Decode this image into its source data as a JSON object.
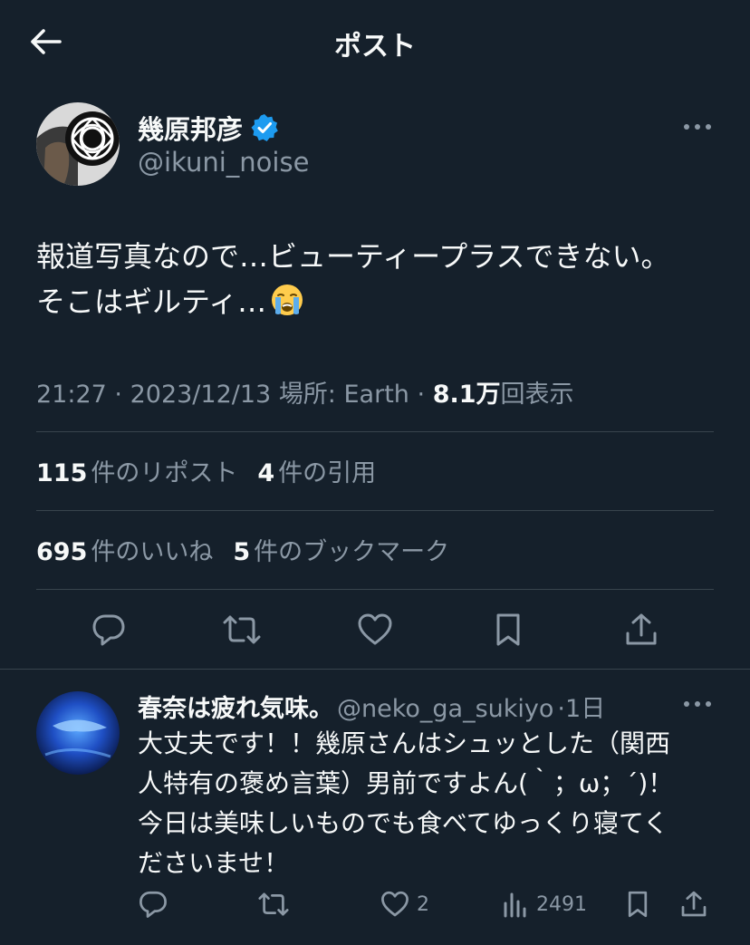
{
  "header": {
    "title": "ポスト",
    "back_icon": "arrow-left-icon"
  },
  "tweet": {
    "author_name": "幾原邦彦",
    "author_handle": "@ikuni_noise",
    "verified": true,
    "text_lines": [
      "報道写真なので…ビューティープラスできない。",
      "そこはギルティ…"
    ],
    "emoji": "loudly-crying-face",
    "time": "21:27",
    "date": "2023/12/13",
    "location_label": "場所: Earth",
    "sep": "·",
    "views_count": "8.1万",
    "views_label": "回表示",
    "reposts_count": "115",
    "reposts_label": "件のリポスト",
    "quotes_count": "4",
    "quotes_label": "件の引用",
    "likes_count": "695",
    "likes_label": "件のいいね",
    "bookmarks_count": "5",
    "bookmarks_label": "件のブックマーク"
  },
  "reply": {
    "name": "春奈は疲れ気味。",
    "handle": "@neko_ga_sukiyo",
    "sep": "·",
    "time": "1日",
    "text_lines": [
      "大丈夫です！！幾原さんはシュッとした（関西",
      "人特有の褒め言葉）男前ですよん(｀；ω；´)！",
      "今日は美味しいものでも食べてゆっくり寝てく",
      "ださいませ！"
    ],
    "likes": "2",
    "views": "2491"
  },
  "colors": {
    "background": "#15202b",
    "text": "#f7f9f9",
    "muted": "#8b98a5",
    "divider": "#38444d",
    "verified": "#1d9bf0"
  }
}
